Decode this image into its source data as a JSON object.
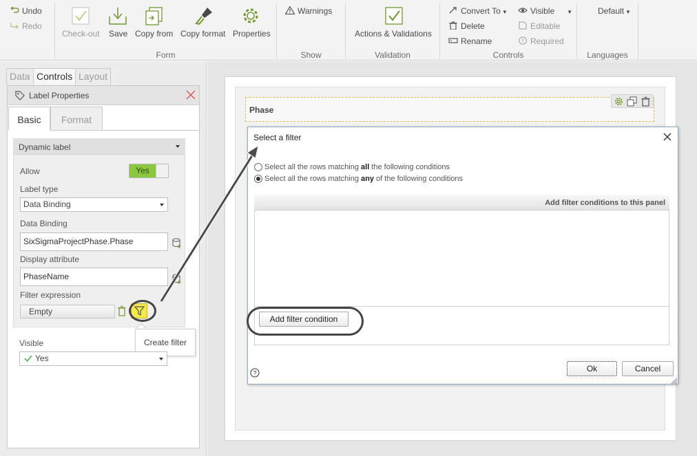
{
  "ribbon": {
    "undo": "Undo",
    "redo": "Redo",
    "form_group": {
      "label": "Form",
      "buttons": [
        "Check-out",
        "Save",
        "Copy from",
        "Copy format",
        "Properties"
      ]
    },
    "show_group": {
      "label": "Show",
      "warnings": "Warnings"
    },
    "validation_group": {
      "label": "Validation",
      "actions": "Actions & Validations"
    },
    "controls_group": {
      "label": "Controls",
      "convert_to": "Convert To",
      "delete": "Delete",
      "rename": "Rename",
      "visible": "Visible",
      "editable": "Editable",
      "required": "Required"
    },
    "languages_group": {
      "label": "Languages",
      "default": "Default"
    }
  },
  "left_tabs": [
    "Data",
    "Controls",
    "Layout"
  ],
  "properties": {
    "title": "Label Properties",
    "subtabs": [
      "Basic",
      "Format"
    ],
    "section_title": "Dynamic label",
    "allow_label": "Allow",
    "allow_value": "Yes",
    "label_type_label": "Label type",
    "label_type_value": "Data Binding",
    "data_binding_label": "Data Binding",
    "data_binding_value": "SixSigmaProjectPhase.Phase",
    "display_attribute_label": "Display attribute",
    "display_attribute_value": "PhaseName",
    "filter_expression_label": "Filter expression",
    "filter_expression_value": "Empty",
    "visible_label": "Visible",
    "visible_value": "Yes"
  },
  "tooltip": "Create filter",
  "canvas": {
    "phase_label": "Phase"
  },
  "dialog": {
    "title": "Select a filter",
    "option_all_pre": "Select all the rows matching ",
    "option_all_bold": "all",
    "option_all_post": " the following conditions",
    "option_any_pre": "Select all the rows matching ",
    "option_any_bold": "any",
    "option_any_post": " of the following conditions",
    "panel_header": "Add filter conditions to this panel",
    "add_condition": "Add filter condition",
    "ok": "Ok",
    "cancel": "Cancel",
    "help": "?"
  },
  "colors": {
    "toggle_green": "#8dc63f",
    "filter_highlight": "#f5e94a",
    "dialog_border": "#8fa8c9",
    "check_green": "#4caf50"
  }
}
